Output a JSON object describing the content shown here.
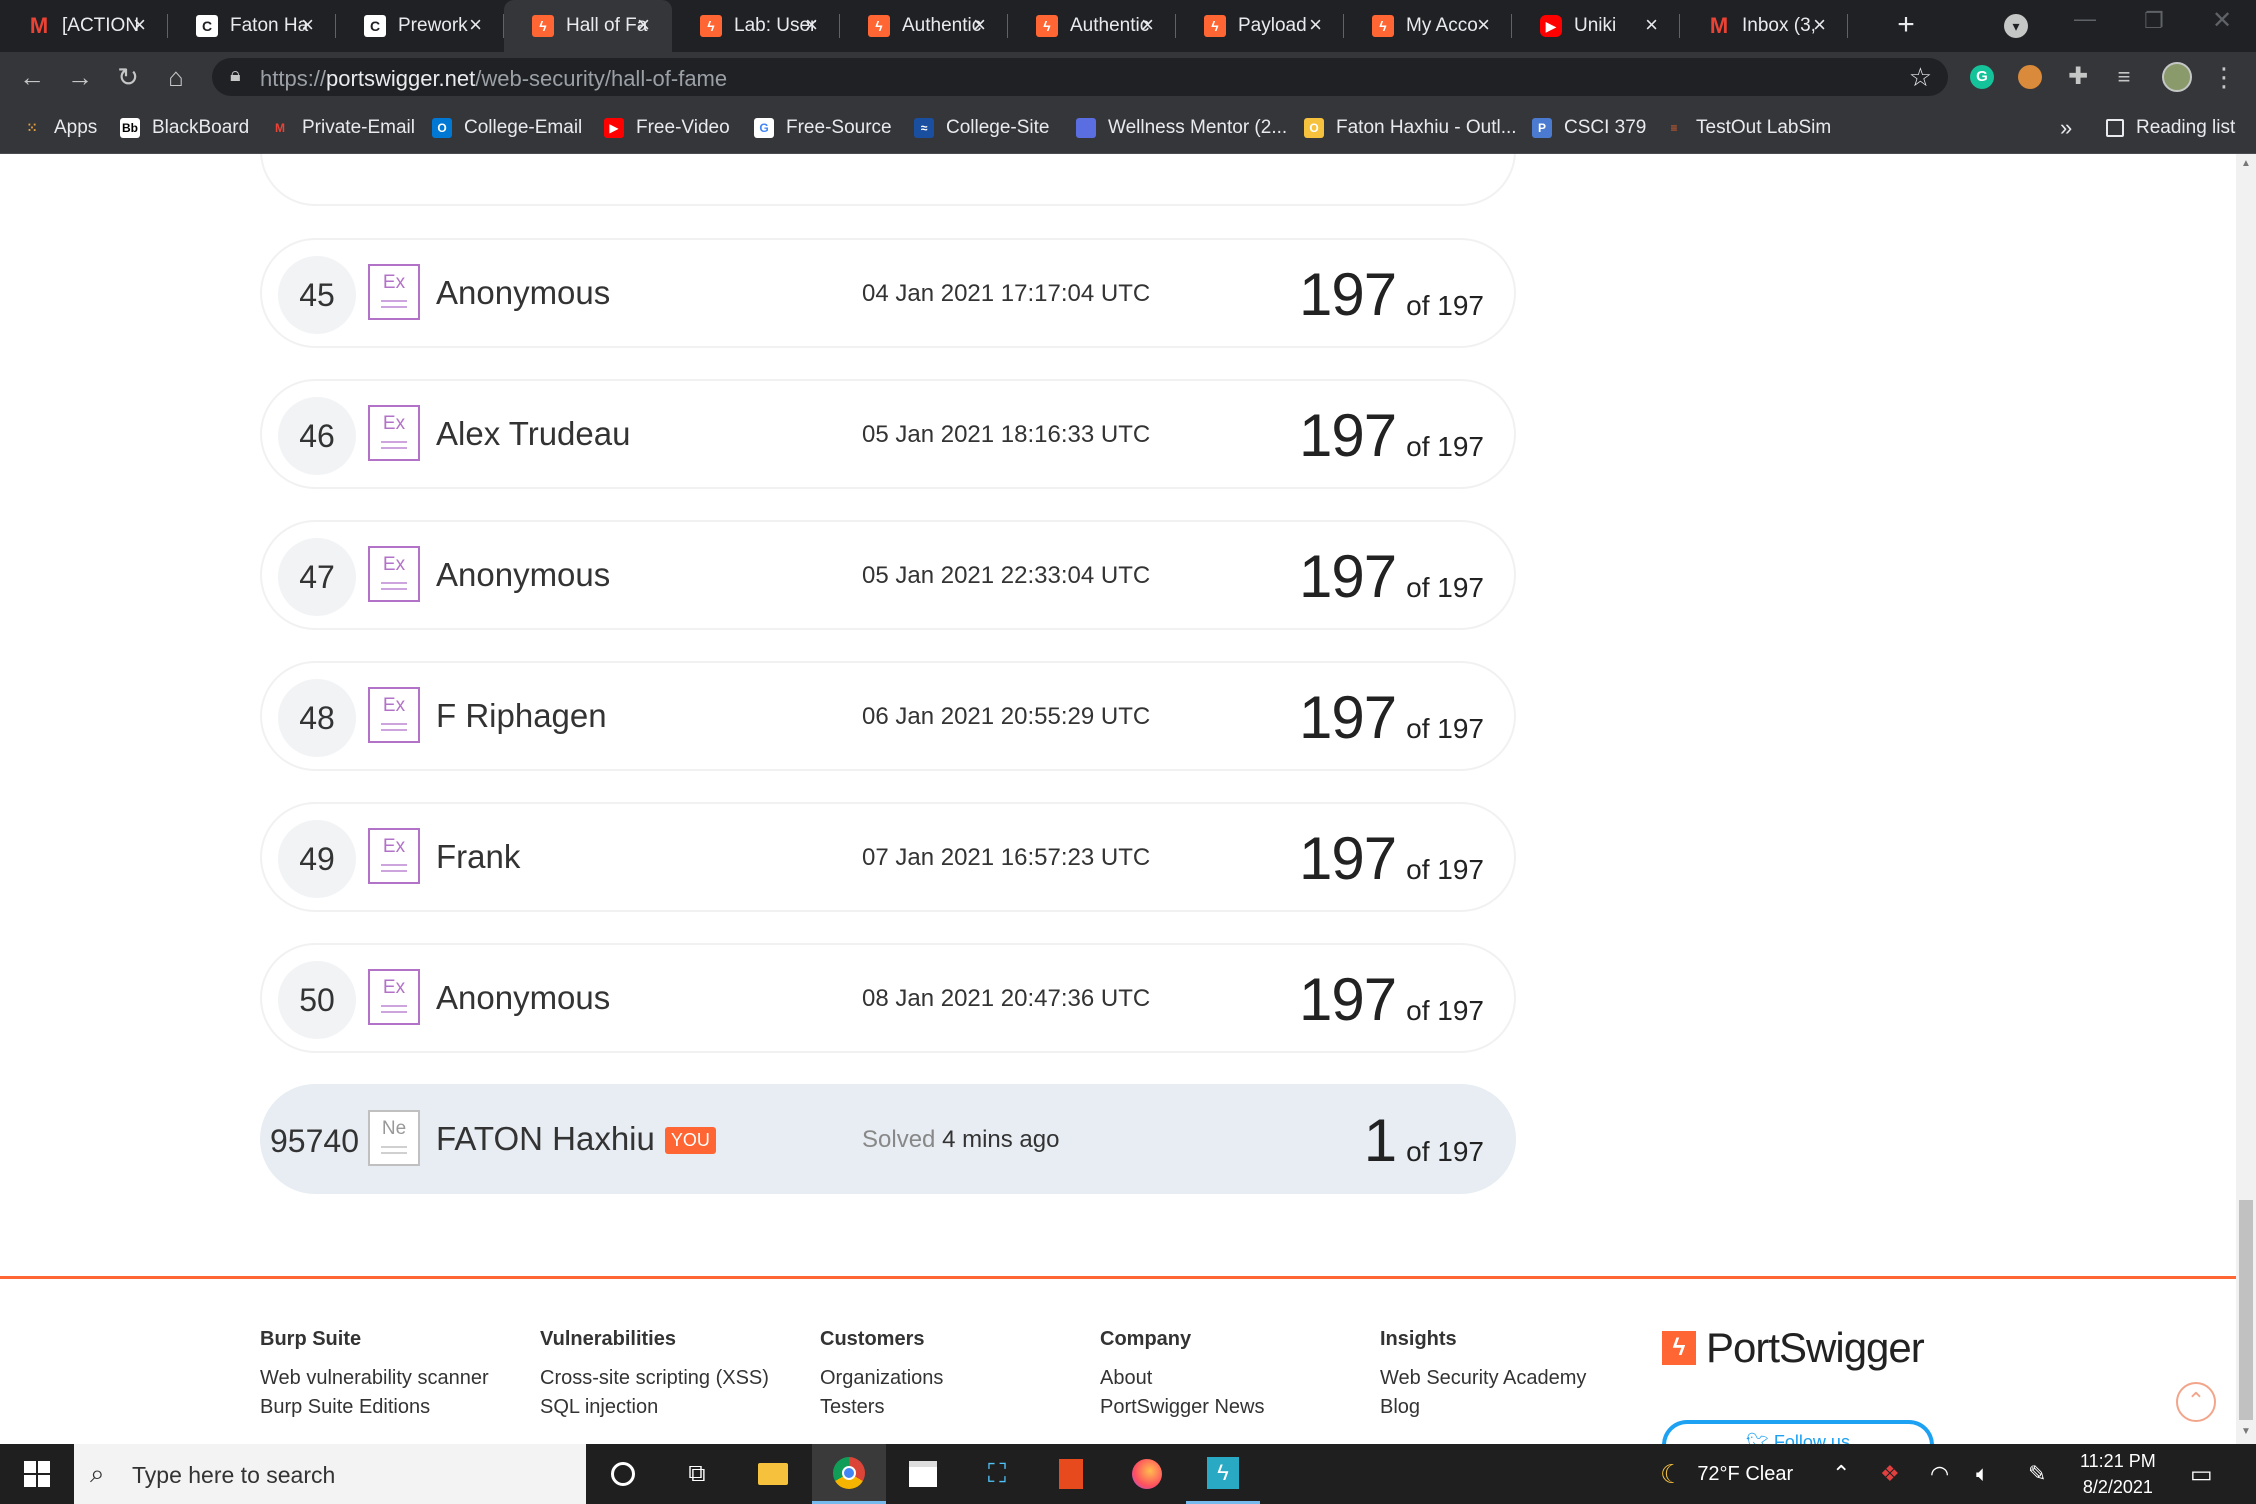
{
  "tabs": [
    {
      "icon": "gmail-icon",
      "title": "[ACTION"
    },
    {
      "icon": "c-icon",
      "title": "Faton Ha"
    },
    {
      "icon": "c-icon",
      "title": "Prework"
    },
    {
      "icon": "portswigger-icon",
      "title": "Hall of Fa",
      "active": true
    },
    {
      "icon": "portswigger-icon",
      "title": "Lab: User"
    },
    {
      "icon": "portswigger-icon",
      "title": "Authentic"
    },
    {
      "icon": "portswigger-icon",
      "title": "Authentic"
    },
    {
      "icon": "portswigger-icon",
      "title": "Payload"
    },
    {
      "icon": "portswigger-icon",
      "title": "My Acco"
    },
    {
      "icon": "youtube-icon",
      "title": "Uniki"
    },
    {
      "icon": "gmail-icon",
      "title": "Inbox (3,"
    }
  ],
  "address": {
    "scheme": "https://",
    "host": "portswigger.net",
    "path": "/web-security/hall-of-fame"
  },
  "bookmarks": [
    {
      "label": "Apps"
    },
    {
      "label": "BlackBoard"
    },
    {
      "label": "Private-Email"
    },
    {
      "label": "College-Email"
    },
    {
      "label": "Free-Video"
    },
    {
      "label": "Free-Source"
    },
    {
      "label": "College-Site"
    },
    {
      "label": "Wellness Mentor (2..."
    },
    {
      "label": "Faton Haxhiu - Outl..."
    },
    {
      "label": "CSCI 379"
    },
    {
      "label": "TestOut LabSim"
    }
  ],
  "bookmarks_overflow": "»",
  "reading_list": "Reading list",
  "leaderboard": [
    {
      "rank": "45",
      "badge": "Ex",
      "name": "Anonymous",
      "date": "04 Jan 2021 17:17:04 UTC",
      "score": "197",
      "total": "of 197"
    },
    {
      "rank": "46",
      "badge": "Ex",
      "name": "Alex Trudeau",
      "date": "05 Jan 2021 18:16:33 UTC",
      "score": "197",
      "total": "of 197"
    },
    {
      "rank": "47",
      "badge": "Ex",
      "name": "Anonymous",
      "date": "05 Jan 2021 22:33:04 UTC",
      "score": "197",
      "total": "of 197"
    },
    {
      "rank": "48",
      "badge": "Ex",
      "name": "F Riphagen",
      "date": "06 Jan 2021 20:55:29 UTC",
      "score": "197",
      "total": "of 197"
    },
    {
      "rank": "49",
      "badge": "Ex",
      "name": "Frank",
      "date": "07 Jan 2021 16:57:23 UTC",
      "score": "197",
      "total": "of 197"
    },
    {
      "rank": "50",
      "badge": "Ex",
      "name": "Anonymous",
      "date": "08 Jan 2021 20:47:36 UTC",
      "score": "197",
      "total": "of 197"
    }
  ],
  "current_user": {
    "rank": "95740",
    "badge": "Ne",
    "name": "FATON Haxhiu",
    "tag": "YOU",
    "solved_label": "Solved",
    "solved_ago": "4 mins ago",
    "score": "1",
    "total": "of 197"
  },
  "footer": {
    "columns": [
      {
        "heading": "Burp Suite",
        "links": [
          "Web vulnerability scanner",
          "Burp Suite Editions"
        ]
      },
      {
        "heading": "Vulnerabilities",
        "links": [
          "Cross-site scripting (XSS)",
          "SQL injection"
        ]
      },
      {
        "heading": "Customers",
        "links": [
          "Organizations",
          "Testers"
        ]
      },
      {
        "heading": "Company",
        "links": [
          "About",
          "PortSwigger News"
        ]
      },
      {
        "heading": "Insights",
        "links": [
          "Web Security Academy",
          "Blog"
        ]
      }
    ],
    "brand": "PortSwigger",
    "follow_label": "Follow us"
  },
  "taskbar": {
    "search_placeholder": "Type here to search",
    "weather": "72°F  Clear",
    "time": "11:21 PM",
    "date": "8/2/2021"
  },
  "colors": {
    "accent": "#ff6633",
    "badge_expert": "#b272c8",
    "current_row": "#e7edf2"
  }
}
